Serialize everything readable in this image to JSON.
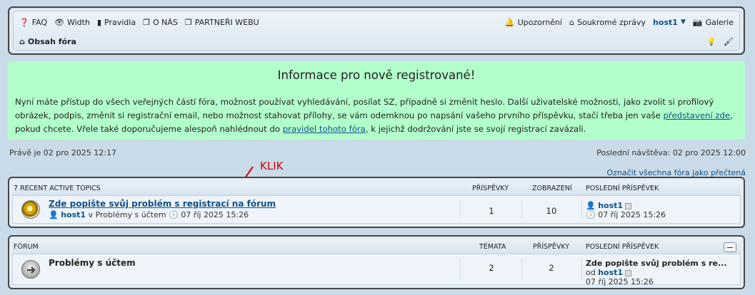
{
  "nav": {
    "faq": "FAQ",
    "width": "Width",
    "rules": "Pravidla",
    "about": "O NÁS",
    "partners": "PARTNEŘI WEBU",
    "notifications": "Upozornění",
    "private_messages": "Soukromé zprávy",
    "username": "host1",
    "gallery": "Galerie",
    "board_index": "Obsah fóra"
  },
  "info": {
    "title": "Informace pro nově registrované!",
    "text_1": "Nyní máte přístup do všech veřejných částí fóra, možnost používat vyhledávání, posílat SZ, případně si změnit heslo. Další uživatelské možnosti, jako zvolit si profilový obrázek, podpis, změnit si registrační email, nebo možnost stahovat přílohy, se vám odemknou po napsání vašeho prvního příspěvku, stačí třeba jen vaše ",
    "link_1": "představení zde",
    "text_2": ", pokud chcete. Vřele také doporučujeme alespoň nahlédnout do ",
    "link_2": "pravidel tohoto fóra",
    "text_3": ", k jejichž dodržování jste se svojí registrací zavázali."
  },
  "status": {
    "now": "Právě je 02 pro 2025 12:17",
    "last_visit": "Poslední návštěva: 02 pro 2025 12:00",
    "mark_all": "Označit všechna fóra jako přečtená"
  },
  "annotation": "KLIK",
  "recent": {
    "header": "7 RECENT ACTIVE TOPICS",
    "col_posts": "PŘÍSPĚVKY",
    "col_views": "ZOBRAZENÍ",
    "col_last": "POSLEDNÍ PŘÍSPĚVEK",
    "topic_title": "Zde popište svůj problém s registrací na fórum",
    "topic_author": "host1",
    "topic_in": "v",
    "topic_forum": "Problémy s účtem",
    "topic_date": "07 říj 2025 15:26",
    "posts": "1",
    "views": "10",
    "last_user": "host1",
    "last_date": "07 říj 2025 15:26"
  },
  "forum": {
    "header": "FÓRUM",
    "col_topics": "TÉMATA",
    "col_posts": "PŘÍSPĚVKY",
    "col_last": "POSLEDNÍ PŘÍSPĚVEK",
    "forum_title": "Problémy s účtem",
    "topics": "2",
    "posts": "2",
    "last_title": "Zde popište svůj problém s re...",
    "last_from": "od",
    "last_user": "host1",
    "last_date": "07 říj 2025 15:26"
  },
  "colors": {
    "info_bg": "#b3ffcc",
    "link": "#105289",
    "annotation": "#d40000"
  }
}
